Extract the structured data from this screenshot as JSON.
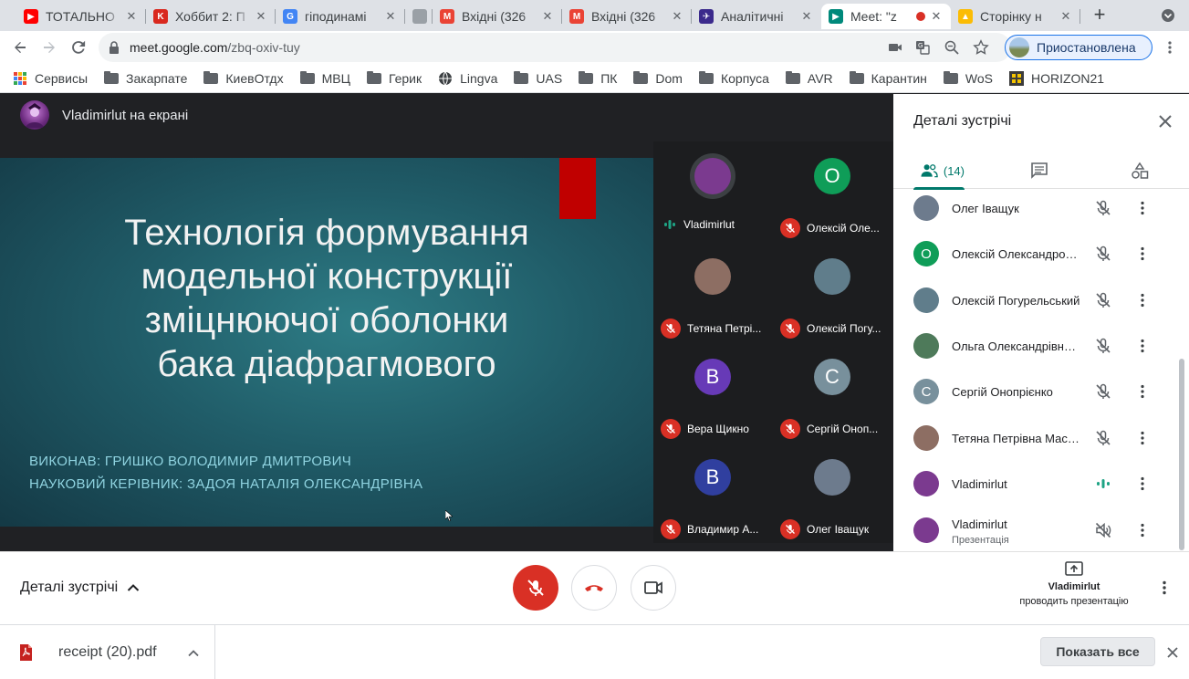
{
  "tabs": [
    {
      "title": "ТОТАЛЬНО",
      "fav_color": "#ff0000",
      "fav_glyph": "▶"
    },
    {
      "title": "Хоббит 2: П",
      "fav_color": "#d9281e",
      "fav_glyph": "K"
    },
    {
      "title": "гіподинамі",
      "fav_color": "#4285f4",
      "fav_glyph": "G"
    },
    {
      "title": "",
      "fav_color": "#9aa0a6",
      "fav_glyph": ""
    },
    {
      "title": "Вхідні (326",
      "fav_color": "#ea4335",
      "fav_glyph": "M"
    },
    {
      "title": "Вхідні (326",
      "fav_color": "#ea4335",
      "fav_glyph": "M"
    },
    {
      "title": "Аналітичні",
      "fav_color": "#3b2a8c",
      "fav_glyph": "✈"
    },
    {
      "title": "Meet: \"z",
      "fav_color": "#00897b",
      "fav_glyph": "▶"
    },
    {
      "title": "Сторінку н",
      "fav_color": "#fbbc04",
      "fav_glyph": "▲"
    }
  ],
  "toolbar": {
    "url_host": "meet.google.com",
    "url_path": "/zbq-oxiv-tuy",
    "profile_label": "Приостановлена"
  },
  "bookmarks": [
    {
      "label": "Сервисы",
      "icon": "apps-icon"
    },
    {
      "label": "Закарпате",
      "icon": "folder-icon"
    },
    {
      "label": "КиевОтдх",
      "icon": "folder-icon"
    },
    {
      "label": "МВЦ",
      "icon": "folder-icon"
    },
    {
      "label": "Герик",
      "icon": "folder-icon"
    },
    {
      "label": "Lingva",
      "icon": "globe-icon"
    },
    {
      "label": "UAS",
      "icon": "folder-icon"
    },
    {
      "label": "ПК",
      "icon": "folder-icon"
    },
    {
      "label": "Dom",
      "icon": "folder-icon"
    },
    {
      "label": "Корпуса",
      "icon": "folder-icon"
    },
    {
      "label": "AVR",
      "icon": "folder-icon"
    },
    {
      "label": "Карантин",
      "icon": "folder-icon"
    },
    {
      "label": "WoS",
      "icon": "folder-icon"
    },
    {
      "label": "HORIZON21",
      "icon": "grid-icon"
    }
  ],
  "stage": {
    "presenter_label": "Vladimirlut на екрані",
    "slide": {
      "title_lines": [
        "Технологія формування",
        "модельної конструкції",
        "зміцнюючої оболонки",
        "бака діафрагмового"
      ],
      "author": "ВИКОНАВ: ГРИШКО ВОЛОДИМИР ДМИТРОВИЧ",
      "supervisor": "НАУКОВИЙ КЕРІВНИК: ЗАДОЯ НАТАЛІЯ ОЛЕКСАНДРІВНА"
    }
  },
  "tiles": [
    {
      "name": "Vladimirlut",
      "initial": "",
      "color": "#7b3a8f",
      "speaking": true
    },
    {
      "name": "Олексій Оле...",
      "initial": "О",
      "color": "#0f9d58",
      "speaking": false
    },
    {
      "name": "Тетяна Петрі...",
      "initial": "",
      "color": "#8d6e63",
      "speaking": false
    },
    {
      "name": "Олексій Погу...",
      "initial": "",
      "color": "#607d8b",
      "speaking": false
    },
    {
      "name": "Вера Щикно",
      "initial": "В",
      "color": "#673ab7",
      "speaking": false
    },
    {
      "name": "Сергій Оноп...",
      "initial": "С",
      "color": "#78909c",
      "speaking": false
    },
    {
      "name": "Владимир А...",
      "initial": "В",
      "color": "#303f9f",
      "speaking": false
    },
    {
      "name": "Олег Іващук",
      "initial": "",
      "color": "#6d7b8d",
      "speaking": false
    }
  ],
  "panel": {
    "title": "Деталі зустрічі",
    "participant_count": "(14)",
    "participants": [
      {
        "name": "Олег Іващук",
        "sub": "",
        "initial": "",
        "color": "#6d7b8d",
        "mic": "muted"
      },
      {
        "name": "Олексій Олександров...",
        "sub": "",
        "initial": "О",
        "color": "#0f9d58",
        "mic": "muted"
      },
      {
        "name": "Олексій Погурельський",
        "sub": "",
        "initial": "",
        "color": "#607d8b",
        "mic": "muted"
      },
      {
        "name": "Ольга Олександрівна ...",
        "sub": "",
        "initial": "",
        "color": "#4e7a5a",
        "mic": "muted"
      },
      {
        "name": "Сергій Онопрієнко",
        "sub": "",
        "initial": "С",
        "color": "#78909c",
        "mic": "muted"
      },
      {
        "name": "Тетяна Петрівна Маслак",
        "sub": "",
        "initial": "",
        "color": "#8d6e63",
        "mic": "muted"
      },
      {
        "name": "Vladimirlut",
        "sub": "",
        "initial": "",
        "color": "#7b3a8f",
        "mic": "speaking"
      },
      {
        "name": "Vladimirlut",
        "sub": "Презентація",
        "initial": "",
        "color": "#7b3a8f",
        "mic": "audio-off"
      }
    ]
  },
  "controls": {
    "details_label": "Деталі зустрічі",
    "present_name": "Vladimirlut",
    "present_status": "проводить презентацію"
  },
  "downloads": {
    "filename": "receipt (20).pdf",
    "show_all": "Показать все"
  }
}
